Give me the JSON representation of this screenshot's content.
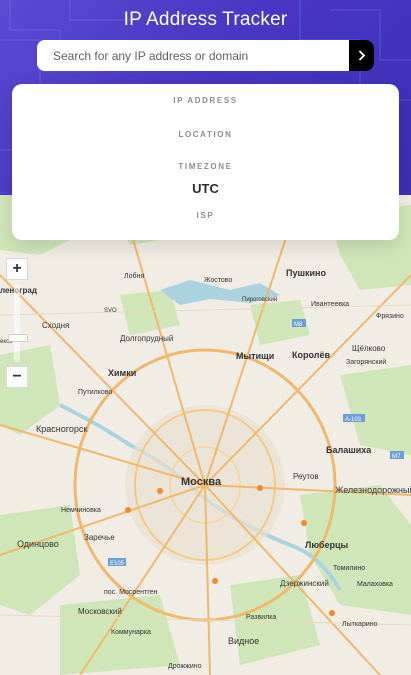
{
  "app": {
    "title": "IP Address Tracker"
  },
  "search": {
    "placeholder": "Search for any IP address or domain",
    "value": ""
  },
  "info": {
    "ip_label": "IP ADDRESS",
    "ip_value": "",
    "location_label": "LOCATION",
    "location_value": "",
    "timezone_label": "TIMEZONE",
    "timezone_value": "UTC",
    "isp_label": "ISP",
    "isp_value": ""
  },
  "map": {
    "labels": {
      "pushkino": "Пушкино",
      "lobnya": "Лобня",
      "zhostova": "Жостово",
      "ivanteevka": "Ивантеевка",
      "pirogovsky": "Пироговский",
      "fryazino": "Фрязино",
      "zelenograd": "леноград",
      "skhodnya": "Сходня",
      "svo": "SVO",
      "dolgoprudny": "Долгопрудный",
      "schyolkovo": "Щёлково",
      "zagoryansky": "Загорянский",
      "mytishchi": "Мытищи",
      "korolyov": "Королёв",
      "khimki": "Химки",
      "putilkovo": "Путилково",
      "krasnogorsk": "Красногорск",
      "balashikha": "Балашиха",
      "moskva": "Москва",
      "reutov": "Реутов",
      "zheleznodorozhny": "Железнодорожный",
      "nemchinovka": "Немчиновка",
      "odintsovo": "Одинцово",
      "zarechye": "Заречье",
      "lyubertsy": "Люберцы",
      "tomilino": "Томилино",
      "mosrentgen": "пос. Мосрентген",
      "dzerzhinsky": "Дзержинский",
      "malakhovka": "Малаховка",
      "moskovsky": "Московский",
      "razvilka": "Развилка",
      "lytkarino": "Лыткарино",
      "kommunarka": "Коммунарка",
      "vidnoye": "Видное",
      "drozhzhino": "Дрожжино",
      "ekso": "ексо",
      "m8": "M8",
      "m7": "M7",
      "a103": "A-103",
      "e105": "E105"
    }
  }
}
